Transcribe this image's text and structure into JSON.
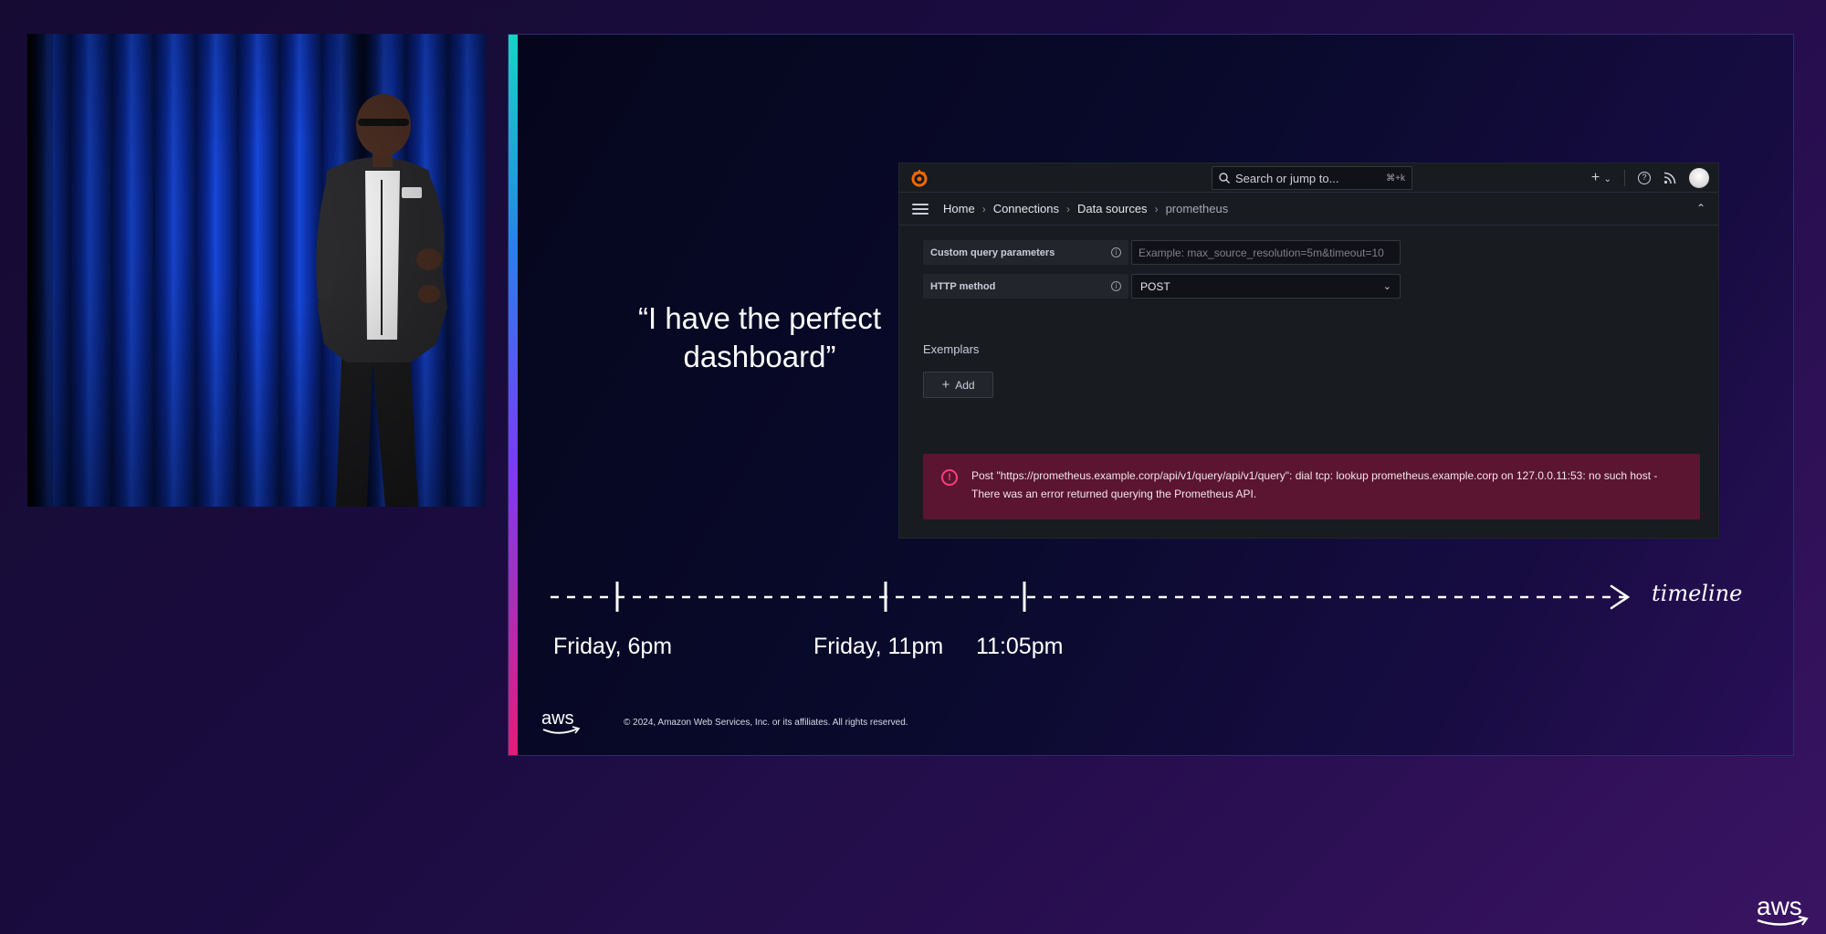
{
  "slide": {
    "quote": "“I have the perfect dashboard”",
    "timeline_label": "timeline",
    "timeline_events": [
      "Friday, 6pm",
      "Friday, 11pm",
      "11:05pm"
    ],
    "footer_copyright": "© 2024, Amazon Web Services, Inc. or its affiliates. All rights reserved.",
    "footer_logo_text": "aws"
  },
  "grafana": {
    "search": {
      "placeholder": "Search or jump to...",
      "shortcut": "⌘+k"
    },
    "breadcrumb": [
      "Home",
      "Connections",
      "Data sources",
      "prometheus"
    ],
    "fields": [
      {
        "label": "Custom query parameters",
        "placeholder": "Example: max_source_resolution=5m&timeout=10"
      },
      {
        "label": "HTTP method",
        "value": "POST"
      }
    ],
    "exemplars_title": "Exemplars",
    "add_label": "Add",
    "error_message": "Post \"https://prometheus.example.corp/api/v1/query/api/v1/query\": dial tcp: lookup prometheus.example.corp on 127.0.0.11:53: no such host - There was an error returned querying the Prometheus API."
  },
  "corner_logo_text": "aws",
  "colors": {
    "accent_gradient": [
      "#19d3c5",
      "#2a7fe8",
      "#7b3cf0",
      "#e01e78"
    ],
    "error_bg": "#5b1530",
    "error_icon": "#ff3d7a",
    "grafana_logo": "#f46800"
  },
  "icons": [
    "grafana-logo-icon",
    "search-icon",
    "plus-icon",
    "chevron-down-icon",
    "help-icon",
    "rss-icon",
    "hamburger-icon",
    "info-icon",
    "error-icon",
    "aws-logo-icon"
  ]
}
